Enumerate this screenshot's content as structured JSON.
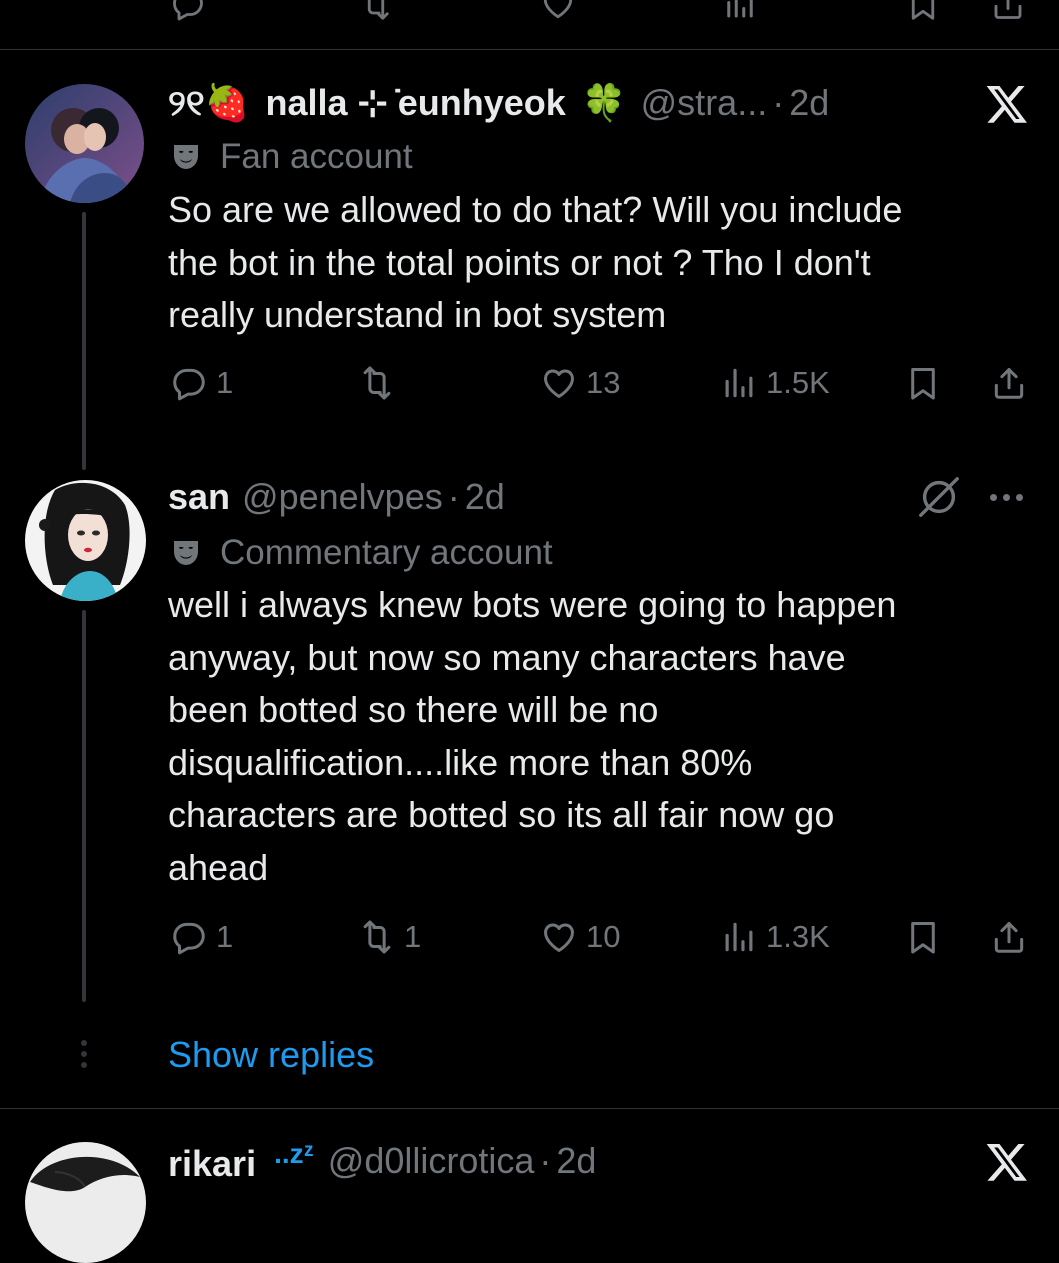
{
  "colors": {
    "background": "#000000",
    "text": "#e7e9ea",
    "secondary": "#71767b",
    "link": "#1d9bf0",
    "border": "#2f3336"
  },
  "posts": [
    {
      "avatar": "avatar-couple-illustration",
      "name_prefix": "୨୧🍓",
      "name": "nalla ⊹ ̇eunhyeok",
      "name_suffix": "🍀",
      "handle": "@stra...",
      "time": "2d",
      "label_icon": "theater-mask-icon",
      "label": "Fan account",
      "text_lines": [
        "So are we allowed to do that? Will you include",
        "the bot in the total points or not ? Tho I don't",
        "really understand in bot system"
      ],
      "actions": {
        "replies": "1",
        "reposts": "",
        "likes": "13",
        "views": "1.5K"
      }
    },
    {
      "avatar": "avatar-anime-girl",
      "name": "san",
      "handle": "@penelvpes",
      "time": "2d",
      "label_icon": "theater-mask-icon",
      "label": "Commentary account",
      "text_lines": [
        "well i always knew bots were going to happen",
        "anyway, but now so many characters have",
        "been botted so there will be no",
        "disqualification....like more than 80%",
        "characters are botted so its all fair now go",
        "ahead"
      ],
      "actions": {
        "replies": "1",
        "reposts": "1",
        "likes": "10",
        "views": "1.3K"
      }
    },
    {
      "avatar": "avatar-sketch",
      "name": "rikari",
      "name_suffix": "..zᶻ",
      "handle": "@d0llicrotica",
      "time": "2d"
    }
  ],
  "show_replies": "Show replies",
  "separator": "·",
  "icons": [
    "reply-icon",
    "repost-icon",
    "like-icon",
    "views-icon",
    "bookmark-icon",
    "share-icon",
    "x-logo-icon",
    "grok-icon",
    "more-icon"
  ]
}
